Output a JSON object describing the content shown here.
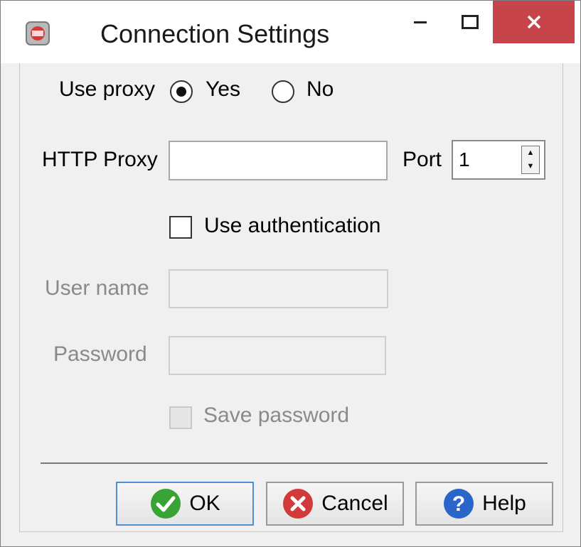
{
  "window": {
    "title": "Connection Settings"
  },
  "proxy": {
    "label": "Use proxy",
    "yes_label": "Yes",
    "no_label": "No",
    "selected": "Yes"
  },
  "http_proxy": {
    "label": "HTTP Proxy",
    "value": ""
  },
  "port": {
    "label": "Port",
    "value": "1"
  },
  "auth": {
    "checkbox_label": "Use authentication",
    "checked": false,
    "user_label": "User name",
    "user_value": "",
    "pass_label": "Password",
    "pass_value": "",
    "save_label": "Save password",
    "save_checked": false
  },
  "buttons": {
    "ok": "OK",
    "cancel": "Cancel",
    "help": "Help"
  },
  "colors": {
    "close_bg": "#c7454a",
    "ok_icon": "#3aa335",
    "cancel_icon": "#d23a3a",
    "help_icon": "#2a66c9"
  }
}
